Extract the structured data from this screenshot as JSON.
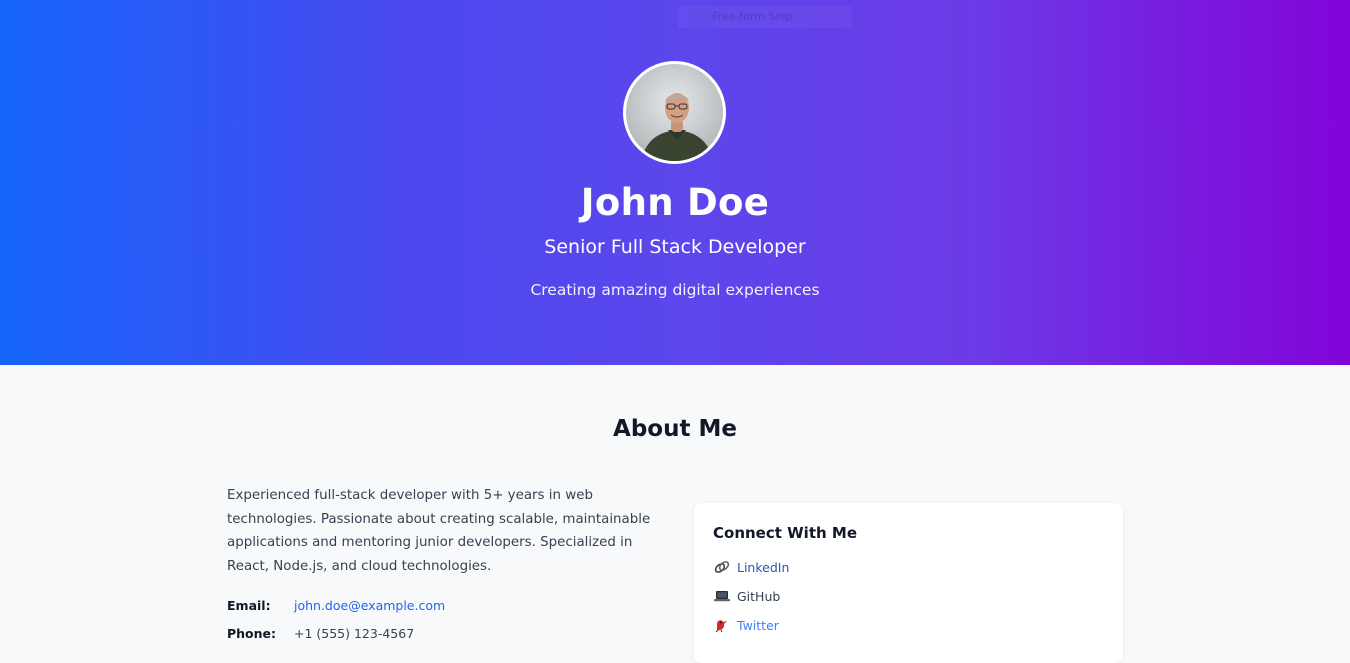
{
  "watermark": "Free-form Snip",
  "profile": {
    "name": "John Doe",
    "role": "Senior Full Stack Developer",
    "tagline": "Creating amazing digital experiences"
  },
  "about": {
    "title": "About Me",
    "bio": "Experienced full-stack developer with 5+ years in web technologies. Passionate about creating scalable, maintainable applications and mentoring junior developers. Specialized in React, Node.js, and cloud technologies.",
    "email_label": "Email:",
    "email": "john.doe@example.com",
    "phone_label": "Phone:",
    "phone": "+1 (555) 123-4567"
  },
  "connect": {
    "title": "Connect With Me",
    "links": [
      {
        "label": "LinkedIn",
        "icon": "linkedin-icon"
      },
      {
        "label": "GitHub",
        "icon": "laptop-icon"
      },
      {
        "label": "Twitter",
        "icon": "bird-icon"
      }
    ]
  },
  "colors": {
    "gradient_start": "#1565fb",
    "gradient_end": "#8204d9",
    "link": "#2563eb"
  }
}
